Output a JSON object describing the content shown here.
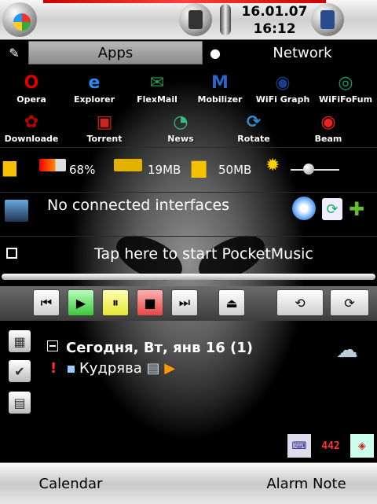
{
  "statusbar": {
    "date": "16.01.07",
    "time": "16:12"
  },
  "tabs": {
    "apps": "Apps",
    "network": "Network"
  },
  "apps": [
    {
      "label": "Opera",
      "icon": "opera-icon",
      "glyph": "O",
      "color": "#d00"
    },
    {
      "label": "Explorer",
      "icon": "explorer-icon",
      "glyph": "e",
      "color": "#2a8bf2"
    },
    {
      "label": "FlexMail",
      "icon": "flexmail-icon",
      "glyph": "✉",
      "color": "#2b9a4a"
    },
    {
      "label": "Mobilizer",
      "icon": "mobilizer-icon",
      "glyph": "M",
      "color": "#2c64c8"
    },
    {
      "label": "WiFi Graph",
      "icon": "wifi-graph-icon",
      "glyph": "◉",
      "color": "#1c3c90"
    },
    {
      "label": "WiFiFoFum",
      "icon": "wififofum-icon",
      "glyph": "◎",
      "color": "#1c9a62"
    },
    {
      "label": "Downloade",
      "icon": "downloader-icon",
      "glyph": "✿",
      "color": "#b00"
    },
    {
      "label": "Torrent",
      "icon": "torrent-icon",
      "glyph": "▣",
      "color": "#c22"
    },
    {
      "label": "News",
      "icon": "news-icon",
      "glyph": "◔",
      "color": "#3b8"
    },
    {
      "label": "Rotate",
      "icon": "rotate-icon",
      "glyph": "⟳",
      "color": "#38c"
    },
    {
      "label": "Beam",
      "icon": "beam-icon",
      "glyph": "◉",
      "color": "#e22"
    }
  ],
  "system": {
    "battery": "68%",
    "memory": "19MB",
    "storage": "50MB",
    "brightness_level": 0.35
  },
  "network": {
    "status": "No connected interfaces"
  },
  "music": {
    "prompt": "Tap here to start PocketMusic"
  },
  "today": {
    "header": "Сегодня, Вт, янв 16 (1)",
    "task": "Кудрява"
  },
  "tray": {
    "counter": "442"
  },
  "softkeys": {
    "left": "Calendar",
    "right": "Alarm Note"
  }
}
